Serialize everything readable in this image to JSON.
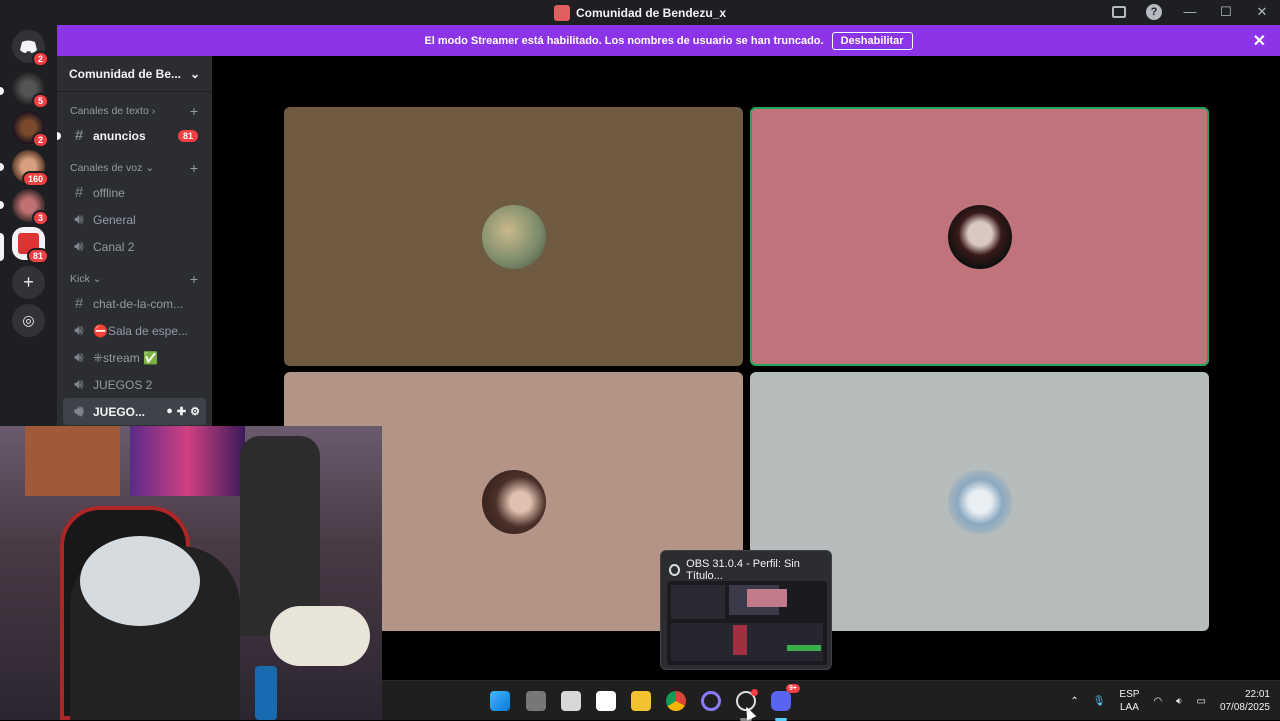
{
  "window": {
    "title": "Comunidad de Bendezu_x",
    "buttons": [
      "inbox-icon",
      "help-icon",
      "minimize",
      "maximize",
      "close"
    ]
  },
  "banner": {
    "text": "El modo Streamer está habilitado. Los nombres de usuario se han truncado.",
    "button": "Deshabilitar"
  },
  "guilds": [
    {
      "name": "discord-home",
      "badge": "2"
    },
    {
      "name": "server-1",
      "badge": "5"
    },
    {
      "name": "server-2",
      "badge": "2"
    },
    {
      "name": "server-3",
      "badge": "160"
    },
    {
      "name": "server-4",
      "badge": "3"
    },
    {
      "name": "server-5",
      "badge": "81"
    }
  ],
  "server": {
    "name": "Comunidad de Be..."
  },
  "categories": {
    "texto": "Canales de texto",
    "voz": "Canales de voz",
    "kick": "Kick"
  },
  "channels": {
    "anuncios": {
      "name": "anuncios",
      "mentions": "81"
    },
    "offline": "offline",
    "general": "General",
    "canal2": "Canal 2",
    "chat": "chat-de-la-com...",
    "sala": "⛔Sala de espe...",
    "stream": "⁜stream ✅",
    "juegos2": "JUEGOS 2",
    "juegos": "JUEGO..."
  },
  "obs": {
    "title": "OBS 31.0.4 - Perfil: Sin Título..."
  },
  "taskbar": {
    "discord_badge": "9+",
    "lang_top": "ESP",
    "lang_bottom": "LAA",
    "time": "22:01",
    "date": "07/08/2025"
  },
  "colors": {
    "tile1": "#6e5b42",
    "tile2": "#c0737a",
    "tile3": "#b59488",
    "tile4": "#b6bcbb",
    "accent_banner": "#8b34e8",
    "speaking": "#23a55a"
  }
}
